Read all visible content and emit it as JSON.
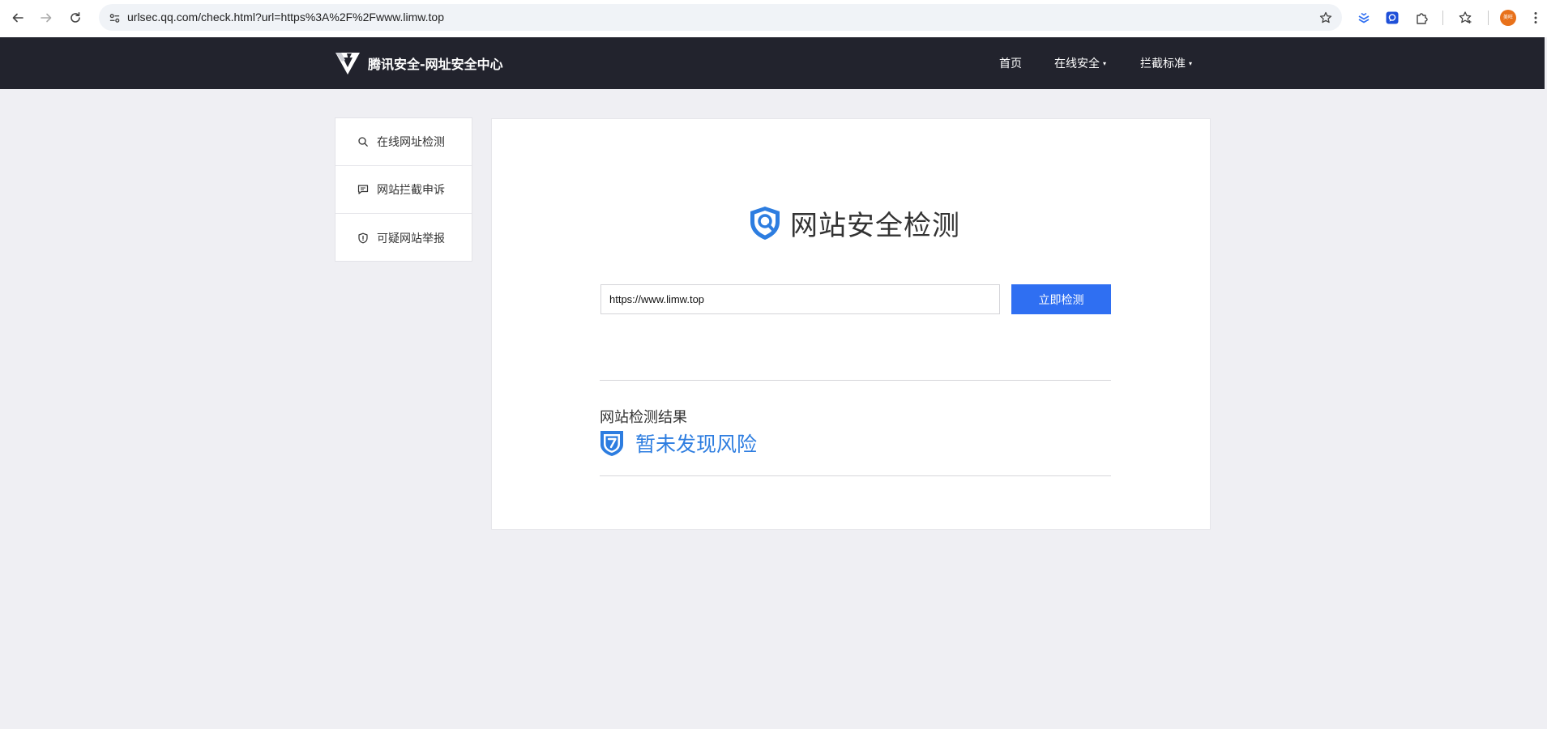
{
  "browser": {
    "url": "urlsec.qq.com/check.html?url=https%3A%2F%2Fwww.limw.top",
    "profile_label": "美旺",
    "icons": [
      "back-icon",
      "forward-icon",
      "reload-icon",
      "site-info-icon",
      "bookmark-star-icon",
      "extension-layers-icon",
      "extension-chat-icon",
      "extensions-puzzle-icon",
      "reading-list-icon",
      "menu-kebab-icon"
    ]
  },
  "header": {
    "logo_text": "腾讯安全-网址安全中心",
    "nav": [
      {
        "label": "首页",
        "has_caret": false
      },
      {
        "label": "在线安全",
        "has_caret": true
      },
      {
        "label": "拦截标准",
        "has_caret": true
      }
    ],
    "caret": "▾"
  },
  "sidebar": {
    "items": [
      {
        "label": "在线网址检测",
        "icon": "search-icon"
      },
      {
        "label": "网站拦截申诉",
        "icon": "chat-icon"
      },
      {
        "label": "可疑网站举报",
        "icon": "shield-icon"
      }
    ]
  },
  "main": {
    "headline": "网站安全检测",
    "input_value": "https://www.limw.top",
    "button_label": "立即检测",
    "result_title": "网站检测结果",
    "result_status": "暂未发现风险"
  },
  "colors": {
    "header_bg": "#22232d",
    "page_bg": "#efeff3",
    "accent_blue": "#2f6ff2",
    "result_blue": "#2d7de0"
  }
}
